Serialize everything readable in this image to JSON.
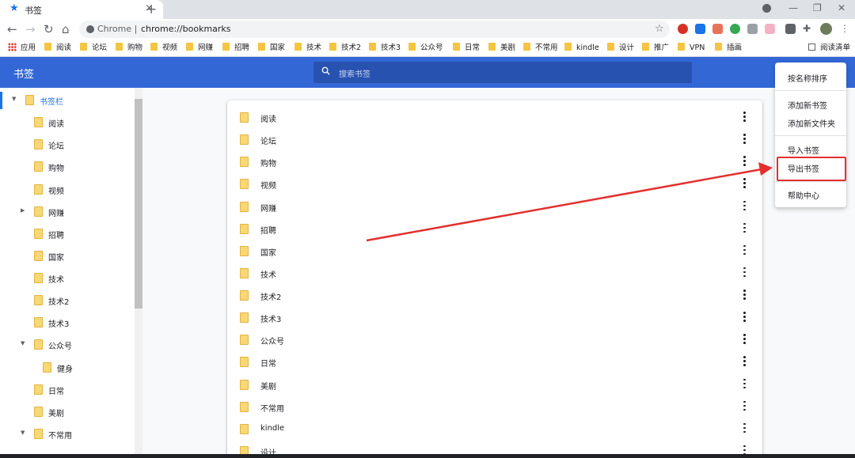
{
  "tab": {
    "title": "书签"
  },
  "toolbar": {
    "scheme_label": "Chrome",
    "url": "chrome://bookmarks"
  },
  "bookmarks_bar": {
    "apps_label": "应用",
    "items": [
      "阅读",
      "论坛",
      "购物",
      "视频",
      "网赚",
      "招聘",
      "国家",
      "技术",
      "技术2",
      "技术3",
      "公众号",
      "日常",
      "美剧",
      "不常用",
      "kindle",
      "设计",
      "推广",
      "VPN",
      "插画"
    ],
    "reading_list": "阅读清单"
  },
  "header": {
    "title": "书签",
    "search_placeholder": "搜索书签"
  },
  "sidebar": {
    "items": [
      {
        "label": "书签栏",
        "expanded": true,
        "selected": true
      },
      {
        "label": "阅读"
      },
      {
        "label": "论坛"
      },
      {
        "label": "购物"
      },
      {
        "label": "视频"
      },
      {
        "label": "网赚",
        "collapsed": true
      },
      {
        "label": "招聘"
      },
      {
        "label": "国家"
      },
      {
        "label": "技术"
      },
      {
        "label": "技术2"
      },
      {
        "label": "技术3"
      },
      {
        "label": "公众号",
        "expanded": true
      },
      {
        "label": "健身"
      },
      {
        "label": "日常"
      },
      {
        "label": "美剧"
      },
      {
        "label": "不常用",
        "expanded": true
      }
    ]
  },
  "list": {
    "items": [
      "阅读",
      "论坛",
      "购物",
      "视频",
      "网赚",
      "招聘",
      "国家",
      "技术",
      "技术2",
      "技术3",
      "公众号",
      "日常",
      "美剧",
      "不常用",
      "kindle",
      "设计"
    ]
  },
  "menu": {
    "sort_by_name": "按名称排序",
    "add_bookmark": "添加新书签",
    "add_folder": "添加新文件夹",
    "import": "导入书签",
    "export": "导出书签",
    "help": "帮助中心"
  },
  "colors": {
    "header": "#3367d6",
    "accent": "#1a73e8",
    "folder": "#f8d775",
    "annotation": "#e3302f"
  }
}
